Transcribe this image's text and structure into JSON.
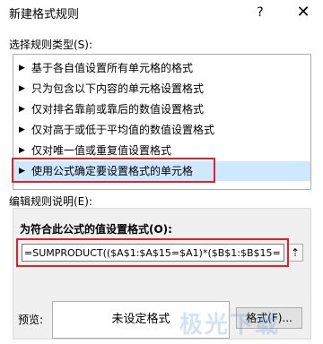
{
  "window": {
    "title": "新建格式规则",
    "help": "?",
    "close": "✕"
  },
  "rule_type_section": {
    "label": "选择规则类型(S):",
    "items": [
      {
        "label": "基于各自值设置所有单元格的格式"
      },
      {
        "label": "只为包含以下内容的单元格设置格式"
      },
      {
        "label": "仅对排名靠前或靠后的数值设置格式"
      },
      {
        "label": "仅对高于或低于平均值的数值设置格式"
      },
      {
        "label": "仅对唯一值或重复值设置格式"
      },
      {
        "label": "使用公式确定要设置格式的单元格"
      }
    ],
    "selected_index": 5
  },
  "edit_section": {
    "label": "编辑规则说明(E):",
    "formula_label": "为符合此公式的值设置格式(O):",
    "formula_value": "=SUMPRODUCT(($A$1:$A$15=$A1)*($B$1:$B$15=",
    "collapse_icon": "⇡"
  },
  "preview": {
    "label": "预览:",
    "text": "未设定格式"
  },
  "buttons": {
    "format": "格式(F)..."
  },
  "watermark": "极光下载",
  "colors": {
    "highlight_frame": "#e0232a",
    "selected_bg": "#cde8ff"
  }
}
